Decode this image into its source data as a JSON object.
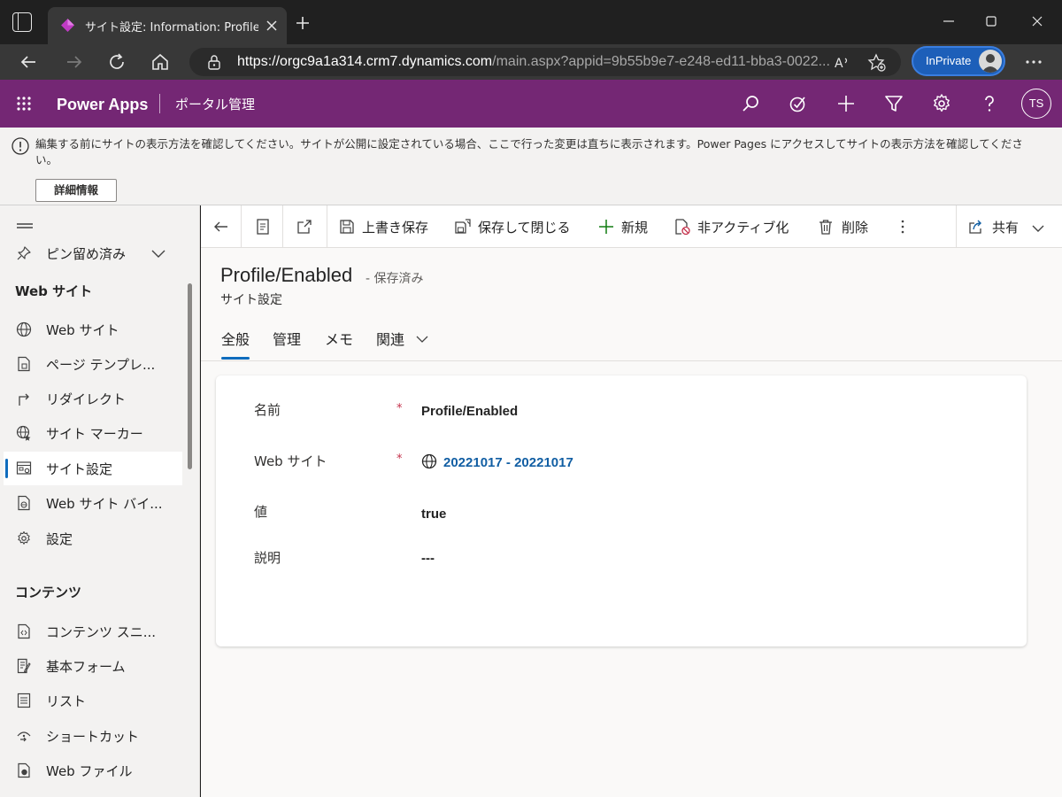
{
  "browser": {
    "tab_title": "サイト設定: Information: Profile/Er",
    "url_host": "https://orgc9a1a314.crm7.dynamics.com",
    "url_path": "/main.aspx?appid=9b55b9e7-e248-ed11-bba3-0022...",
    "inprivate_label": "InPrivate",
    "accent": "#1d5fb9"
  },
  "app": {
    "name": "Power Apps",
    "area": "ポータル管理",
    "user_initials": "TS",
    "brand_color": "#742774"
  },
  "notice": {
    "text": "編集する前にサイトの表示方法を確認してください。サイトが公開に設定されている場合、ここで行った変更は直ちに表示されます。Power Pages にアクセスしてサイトの表示方法を確認してください。",
    "button_label": "詳細情報"
  },
  "sidebar": {
    "pinned_label": "ピン留め済み",
    "website_section": "Web サイト",
    "website_items": [
      {
        "label": "Web サイト",
        "icon": "globe-icon"
      },
      {
        "label": "ページ テンプレ...",
        "icon": "page-template-icon"
      },
      {
        "label": "リダイレクト",
        "icon": "redirect-icon"
      },
      {
        "label": "サイト マーカー",
        "icon": "site-marker-icon"
      },
      {
        "label": "サイト設定",
        "icon": "site-settings-icon",
        "selected": true
      },
      {
        "label": "Web サイト バイ...",
        "icon": "website-binding-icon"
      },
      {
        "label": "設定",
        "icon": "gear-icon"
      }
    ],
    "content_section": "コンテンツ",
    "content_items": [
      {
        "label": "コンテンツ スニ...",
        "icon": "content-snippet-icon"
      },
      {
        "label": "基本フォーム",
        "icon": "basic-form-icon"
      },
      {
        "label": "リスト",
        "icon": "list-icon"
      },
      {
        "label": "ショートカット",
        "icon": "shortcut-icon"
      },
      {
        "label": "Web ファイル",
        "icon": "web-file-icon"
      }
    ]
  },
  "commands": {
    "save": "上書き保存",
    "save_close": "保存して閉じる",
    "new": "新規",
    "deactivate": "非アクティブ化",
    "delete": "削除",
    "share": "共有"
  },
  "record": {
    "title": "Profile/Enabled",
    "status": "- 保存済み",
    "entity": "サイト設定"
  },
  "form_tabs": {
    "general": "全般",
    "admin": "管理",
    "notes": "メモ",
    "related": "関連"
  },
  "fields": {
    "name_label": "名前",
    "name_value": "Profile/Enabled",
    "website_label": "Web サイト",
    "website_value": "20221017 - 20221017",
    "value_label": "値",
    "value_value": "true",
    "description_label": "説明",
    "description_value": "---",
    "required_mark": "*"
  }
}
